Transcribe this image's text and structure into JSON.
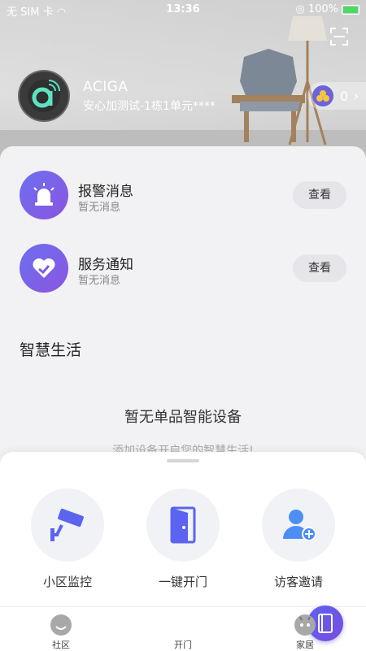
{
  "status_bar": {
    "carrier": "无 SIM 卡",
    "time": "13:36",
    "battery": "100%"
  },
  "header": {
    "user_name": "ACIGA",
    "address": "安心加测试-1栋1单元****",
    "points": "0"
  },
  "messages": [
    {
      "title": "报警消息",
      "subtitle": "暂无消息",
      "button": "查看"
    },
    {
      "title": "服务通知",
      "subtitle": "暂无消息",
      "button": "查看"
    }
  ],
  "smart_life": {
    "title": "智慧生活",
    "empty_title": "暂无单品智能设备",
    "empty_subtitle": "添加设备开启您的智慧生活!"
  },
  "quick_actions": [
    {
      "label": "小区监控",
      "icon": "surveillance-camera-icon"
    },
    {
      "label": "一键开门",
      "icon": "door-icon"
    },
    {
      "label": "访客邀请",
      "icon": "add-person-icon"
    }
  ],
  "tabbar": [
    {
      "label": "社区",
      "icon": "community-icon"
    },
    {
      "label": "开门",
      "icon": "open-door-icon"
    },
    {
      "label": "家居",
      "icon": "home-robot-icon"
    }
  ],
  "colors": {
    "accent": "#6a5ae6",
    "icon_blue": "#5b63f0"
  }
}
